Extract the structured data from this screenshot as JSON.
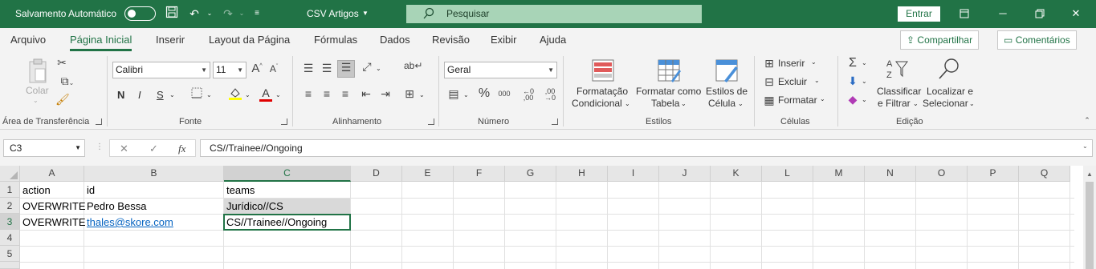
{
  "titlebar": {
    "autosave_label": "Salvamento Automático",
    "doc_title": "CSV Artigos",
    "search_placeholder": "Pesquisar",
    "signin_label": "Entrar"
  },
  "menu": {
    "tabs": [
      "Arquivo",
      "Página Inicial",
      "Inserir",
      "Layout da Página",
      "Fórmulas",
      "Dados",
      "Revisão",
      "Exibir",
      "Ajuda"
    ],
    "active_tab": "Página Inicial",
    "share_label": "Compartilhar",
    "comments_label": "Comentários"
  },
  "ribbon": {
    "clipboard": {
      "paste_label": "Colar",
      "group_label": "Área de Transferência"
    },
    "font": {
      "font_name": "Calibri",
      "font_size": "11",
      "bold": "N",
      "italic": "I",
      "underline": "S",
      "group_label": "Fonte"
    },
    "alignment": {
      "group_label": "Alinhamento"
    },
    "number": {
      "format": "Geral",
      "group_label": "Número"
    },
    "styles": {
      "conditional_formatting": [
        "Formatação",
        "Condicional"
      ],
      "format_as_table": [
        "Formatar como",
        "Tabela"
      ],
      "cell_styles": [
        "Estilos de",
        "Célula"
      ],
      "group_label": "Estilos"
    },
    "cells": {
      "insert": "Inserir",
      "delete": "Excluir",
      "format": "Formatar",
      "group_label": "Células"
    },
    "editing": {
      "sort_filter": [
        "Classificar",
        "e Filtrar"
      ],
      "find_select": [
        "Localizar e",
        "Selecionar"
      ],
      "group_label": "Edição"
    }
  },
  "formula_bar": {
    "name_box": "C3",
    "fx_symbol": "fx",
    "formula": "CS//Trainee//Ongoing"
  },
  "sheet": {
    "columns": [
      "A",
      "B",
      "C",
      "D",
      "E",
      "F",
      "G",
      "H",
      "I",
      "J",
      "K",
      "L",
      "M",
      "N",
      "O",
      "P",
      "Q"
    ],
    "rows": [
      "1",
      "2",
      "3",
      "4",
      "5"
    ],
    "cells": {
      "A1": "action",
      "B1": "id",
      "C1": "teams",
      "A2": "OVERWRITE",
      "B2": "Pedro Bessa",
      "C2": "Jurídico//CS",
      "A3": "OVERWRITE",
      "B3": "thales@skore.com",
      "C3": "CS//Trainee//Ongoing"
    },
    "link_color": "#0563c1",
    "accent_color": "#217346"
  }
}
